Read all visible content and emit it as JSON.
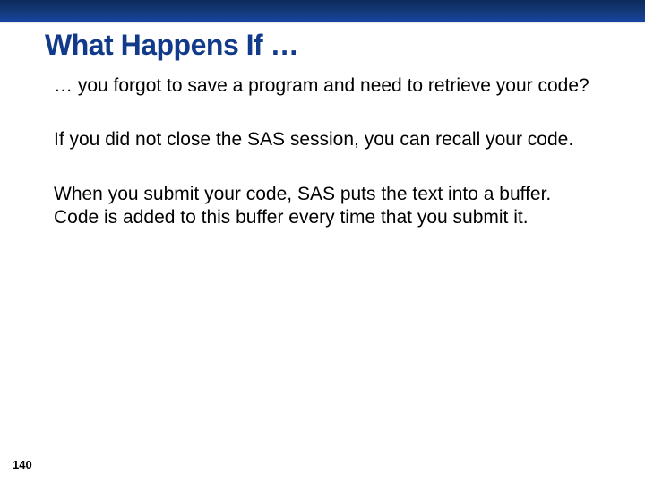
{
  "slide": {
    "title": "What Happens If …",
    "para1": "… you forgot to save a program and need to retrieve your code?",
    "para2": "If you did not close the SAS session, you can recall your code.",
    "para3": "When you submit your code, SAS puts the text into a buffer. Code is added to this buffer every time that you submit it."
  },
  "page_number": "140"
}
